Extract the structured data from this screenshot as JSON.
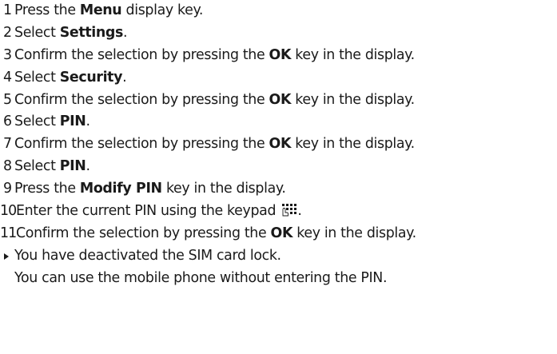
{
  "steps": [
    {
      "num": "1",
      "pre": "Press the ",
      "bold": "Menu",
      "post": " display key."
    },
    {
      "num": "2",
      "pre": "Select ",
      "bold": "Settings",
      "post": "."
    },
    {
      "num": "3",
      "pre": "Confirm the selection by pressing the ",
      "bold": "OK",
      "post": " key in the display."
    },
    {
      "num": "4",
      "pre": "Select ",
      "bold": "Security",
      "post": "."
    },
    {
      "num": "5",
      "pre": "Confirm the selection by pressing the ",
      "bold": "OK",
      "post": " key in the display."
    },
    {
      "num": "6",
      "pre": "Select ",
      "bold": "PIN",
      "post": "."
    },
    {
      "num": "7",
      "pre": "Confirm the selection by pressing the ",
      "bold": "OK",
      "post": " key in the display."
    },
    {
      "num": "8",
      "pre": "Select ",
      "bold": "PIN",
      "post": "."
    },
    {
      "num": "9",
      "pre": "Press the ",
      "bold": "Modify PIN",
      "post": " key in the display."
    },
    {
      "num": "10",
      "pre": "Enter the current PIN using the keypad ",
      "bold": "",
      "post": "."
    },
    {
      "num": "11",
      "pre": "Confirm the selection by pressing the ",
      "bold": "OK",
      "post": " key in the display."
    }
  ],
  "keypad_icon": "keypad-icon",
  "result": {
    "marker_icon": "triangle-right-icon",
    "line1": "You have deactivated the SIM card lock.",
    "line2": "You can use the mobile phone without entering the PIN."
  }
}
